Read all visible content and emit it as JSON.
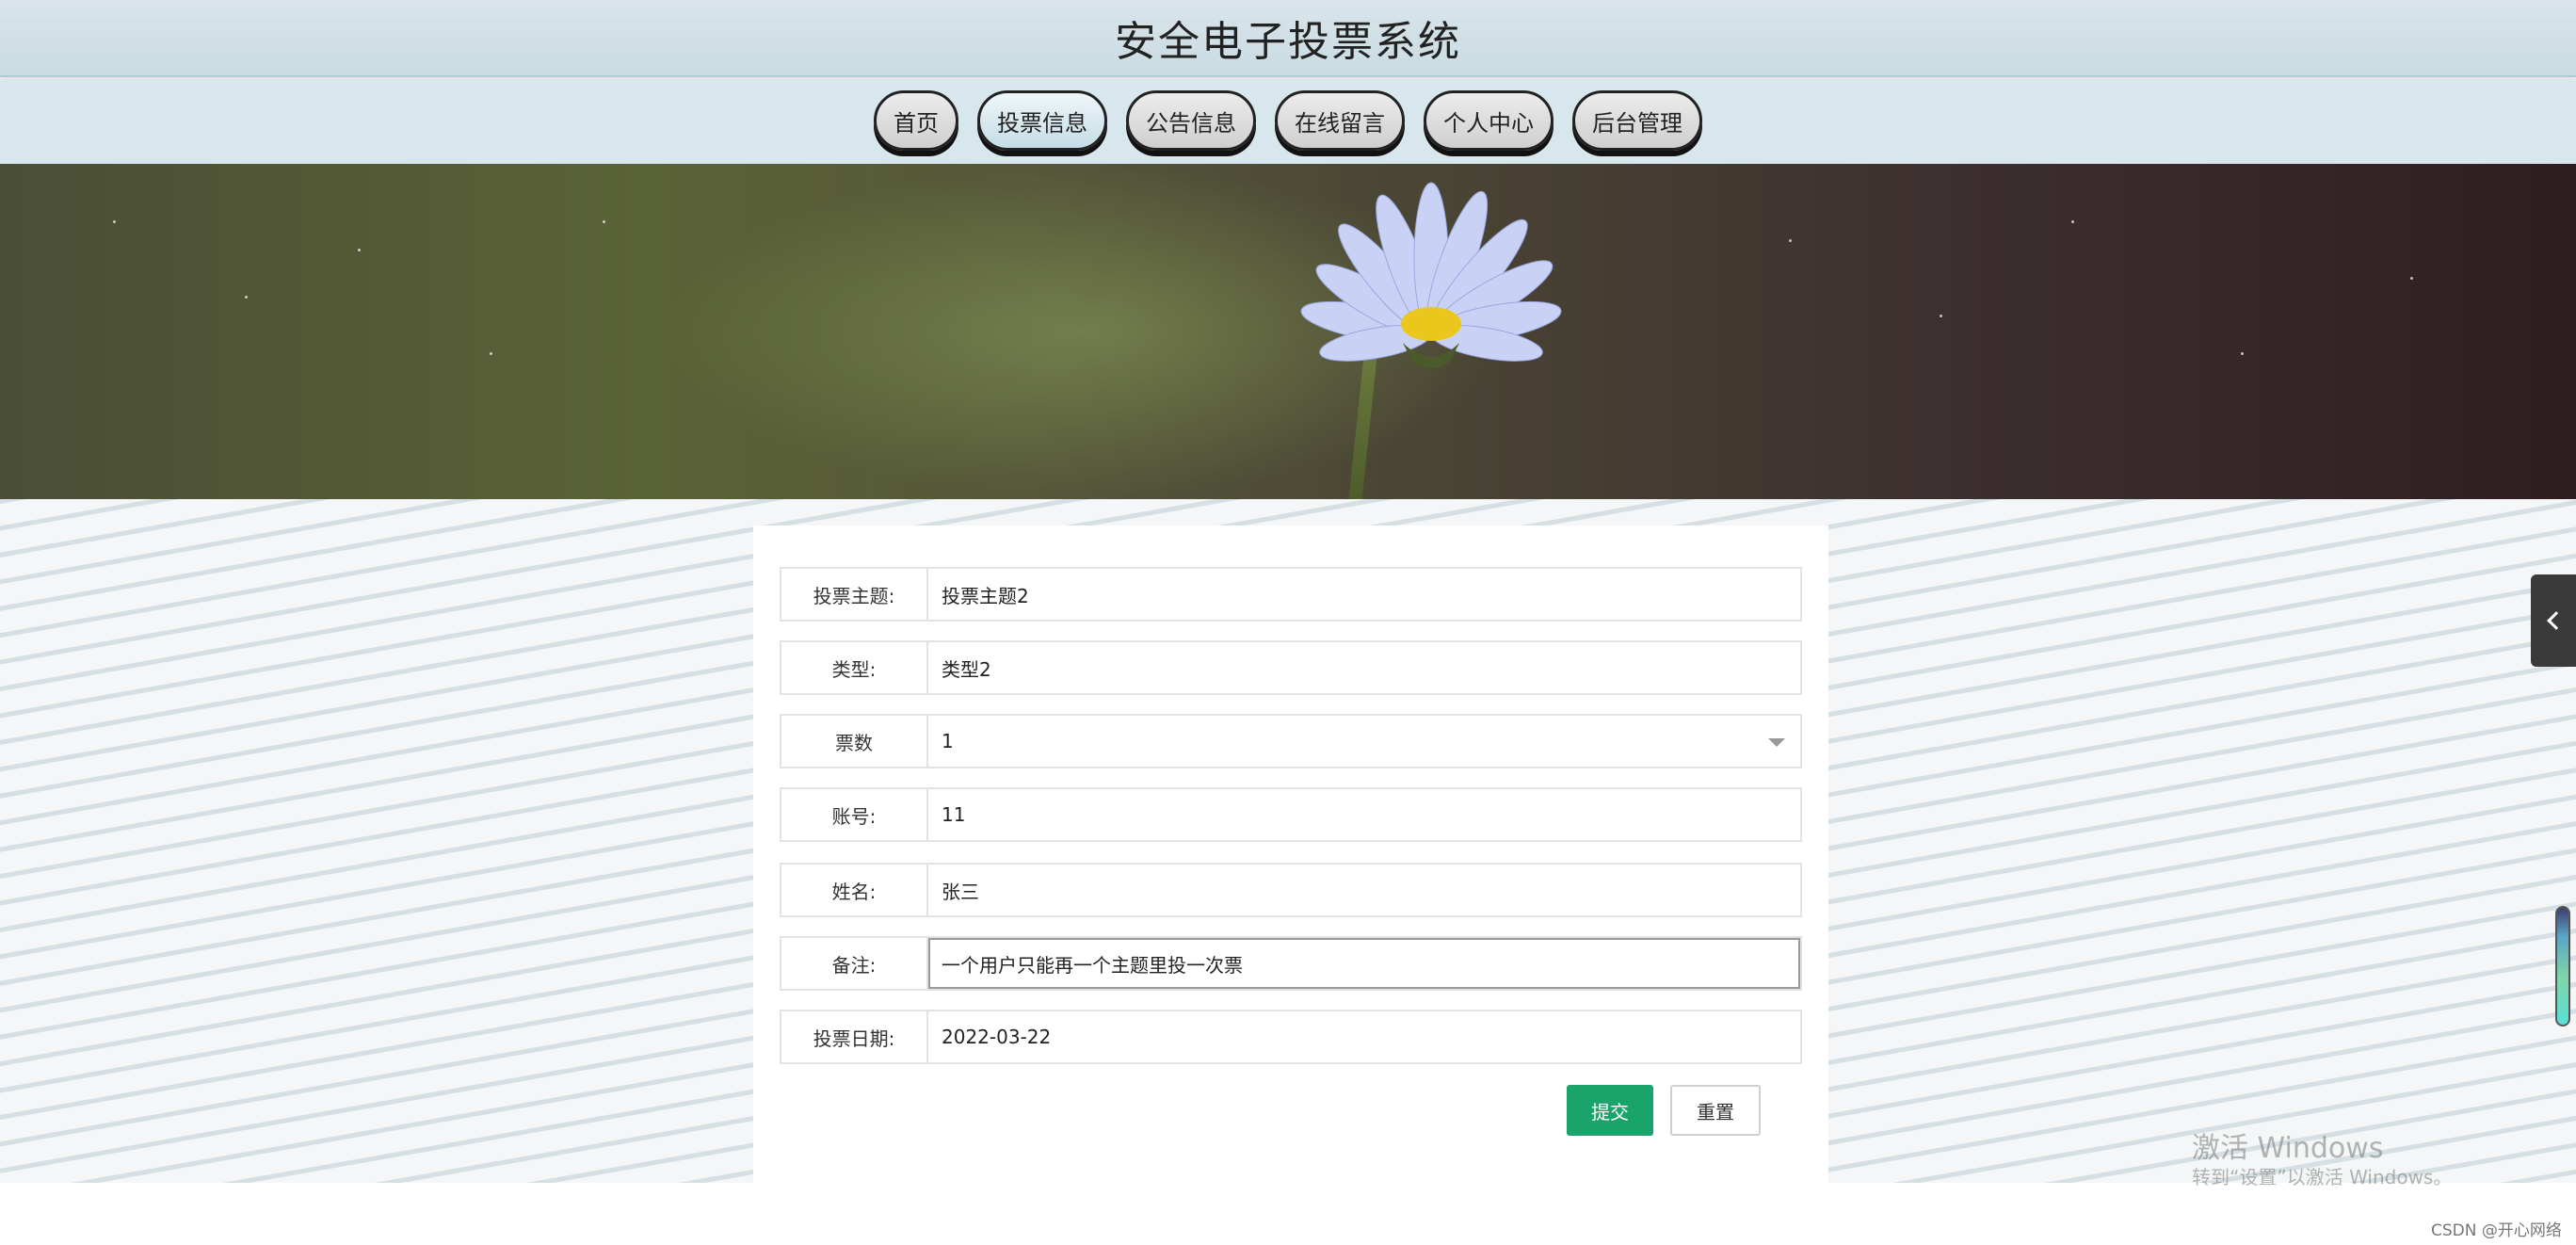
{
  "header": {
    "title": "安全电子投票系统"
  },
  "nav": {
    "items": [
      {
        "label": "首页"
      },
      {
        "label": "投票信息"
      },
      {
        "label": "公告信息"
      },
      {
        "label": "在线留言"
      },
      {
        "label": "个人中心"
      },
      {
        "label": "后台管理"
      }
    ]
  },
  "form": {
    "fields": [
      {
        "label": "投票主题:",
        "value": "投票主题2"
      },
      {
        "label": "类型:",
        "value": "类型2"
      },
      {
        "label": "票数",
        "value": "1"
      },
      {
        "label": "账号:",
        "value": "11"
      },
      {
        "label": "姓名:",
        "value": "张三"
      },
      {
        "label": "备注:",
        "value": "一个用户只能再一个主题里投一次票"
      },
      {
        "label": "投票日期:",
        "value": "2022-03-22"
      }
    ],
    "submit_label": "提交",
    "reset_label": "重置"
  },
  "watermark": {
    "title": "激活 Windows",
    "subtitle": "转到“设置”以激活 Windows。"
  },
  "credit": "CSDN @开心网络",
  "colors": {
    "submit": "#1aa36a",
    "header": "#cfdfe6"
  },
  "icons": {
    "side_tab": "chevron-left-icon",
    "select": "chevron-down-icon"
  }
}
